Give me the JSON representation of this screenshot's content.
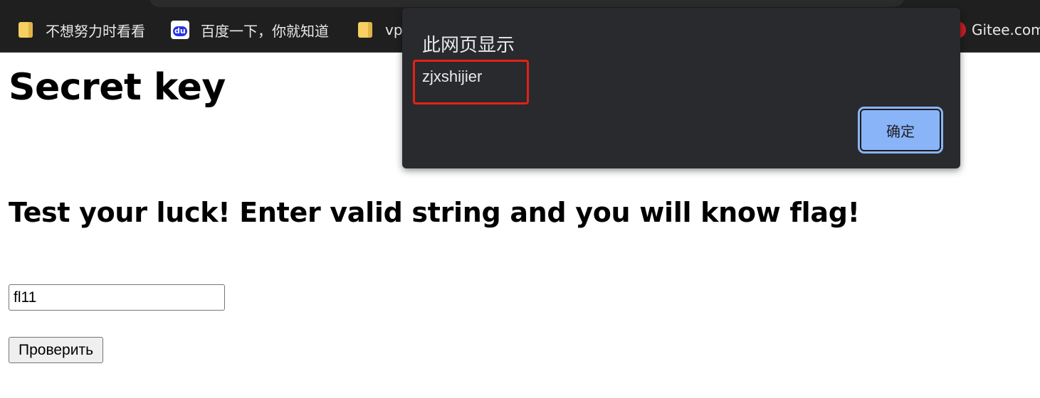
{
  "browser": {
    "bookmarks": [
      {
        "label": "不想努力时看看",
        "icon": "folder-icon"
      },
      {
        "label": "百度一下，你就知道",
        "icon": "baidu-icon"
      },
      {
        "label": "vp",
        "icon": "folder-icon"
      },
      {
        "label": "Gitee.com",
        "icon": "gitee-icon"
      }
    ]
  },
  "page": {
    "title": "Secret key",
    "subtitle": "Test your luck! Enter valid string and you will know flag!",
    "input_value": "fl11",
    "submit_label": "Проверить"
  },
  "dialog": {
    "title": "此网页显示",
    "message": "zjxshijier",
    "ok_label": "确定",
    "highlight_color": "#e32216",
    "ok_color": "#8ab4f8"
  }
}
